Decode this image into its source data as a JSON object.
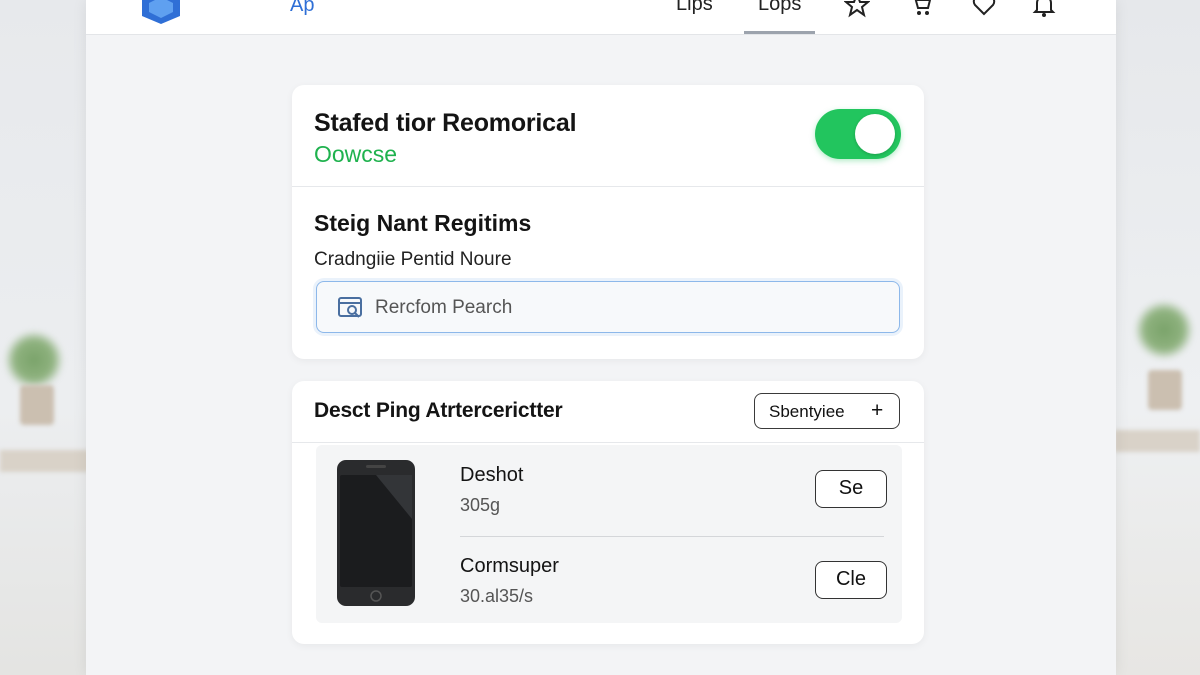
{
  "header": {
    "app_name": "Ap",
    "tabs": [
      {
        "label": "Lips"
      },
      {
        "label": "Lops",
        "active": true
      }
    ],
    "icons": [
      "star-icon",
      "cart-icon",
      "heart-icon",
      "bell-icon"
    ],
    "accent_color": "#2f6fd6"
  },
  "settings_card": {
    "title": "Stafed tior Reomorical",
    "subtitle": "Oowcse",
    "toggle_on": true,
    "toggle_color": "#22c55e",
    "section_title": "Steig Nant Regitims",
    "field_label": "Cradngiie Pentid Noure",
    "search_placeholder": "Rercfom Pearch"
  },
  "devices_card": {
    "title": "Desct Ping Atrtercerictter",
    "add_button_label": "Sbentyiee",
    "items": [
      {
        "name": "Deshot",
        "meta": "305g",
        "button": "Se"
      },
      {
        "name": "Cormsuper",
        "meta": "30.al35/s",
        "button": "Cle"
      }
    ]
  }
}
